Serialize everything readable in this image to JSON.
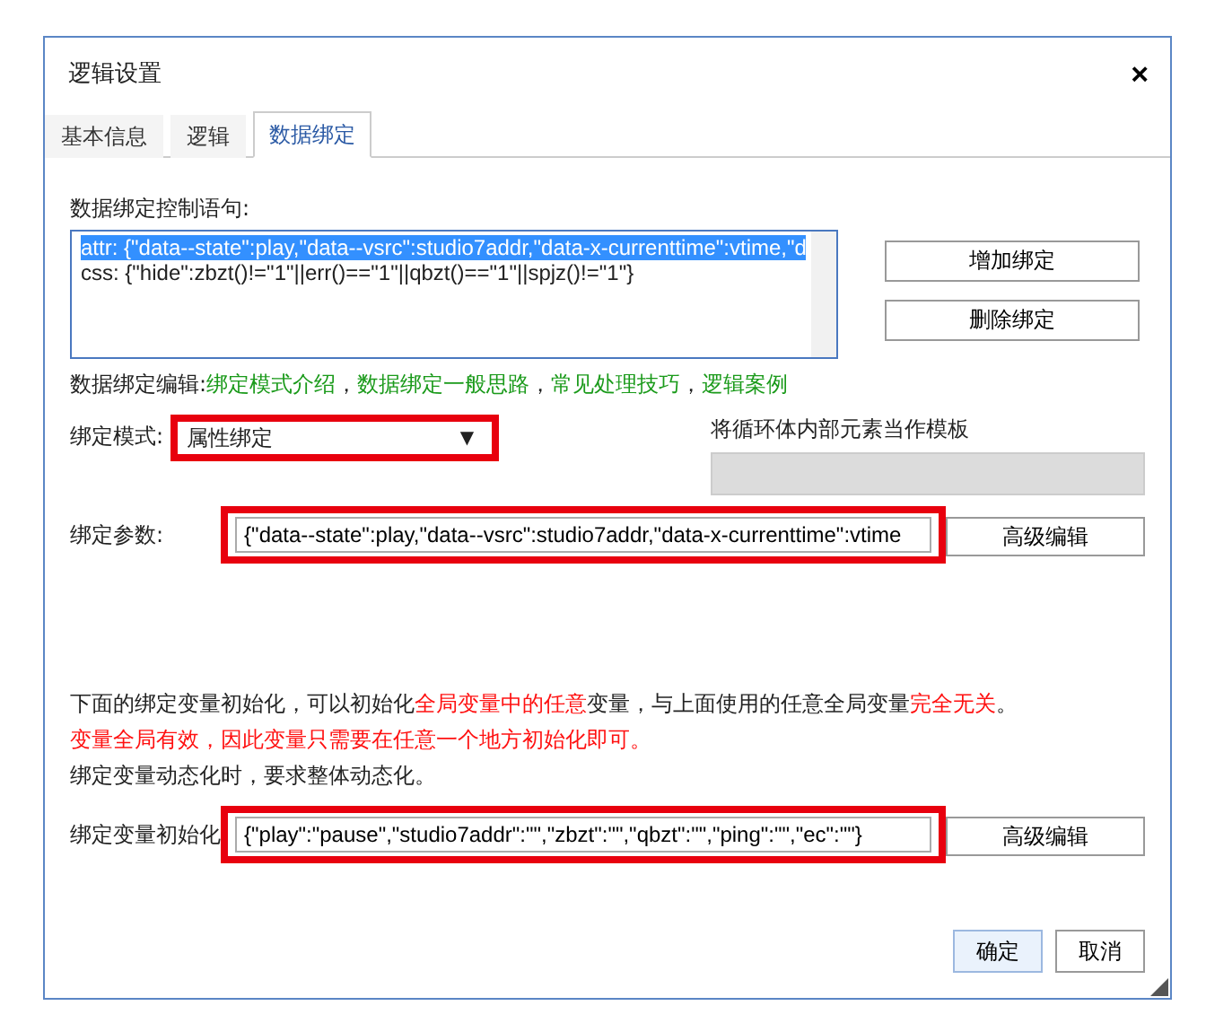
{
  "window": {
    "title": "逻辑设置",
    "close": "×"
  },
  "tabs": [
    {
      "label": "基本信息",
      "selected": false
    },
    {
      "label": "逻辑",
      "selected": false
    },
    {
      "label": "数据绑定",
      "selected": true
    }
  ],
  "statement": {
    "label": "数据绑定控制语句:",
    "lines": [
      {
        "text": "attr: {\"data--state\":play,\"data--vsrc\":studio7addr,\"data-x-currenttime\":vtime,\"d",
        "selected": true
      },
      {
        "text": "css: {\"hide\":zbzt()!=\"1\"||err()==\"1\"||qbzt()==\"1\"||spjz()!=\"1\"}",
        "selected": false
      }
    ]
  },
  "side_buttons": [
    "增加绑定",
    "删除绑定"
  ],
  "edit_links": {
    "label": "数据绑定编辑:",
    "links": [
      "绑定模式介绍",
      "数据绑定一般思路",
      "常见处理技巧",
      "逻辑案例"
    ],
    "separator": "，"
  },
  "mode": {
    "label": "绑定模式:",
    "value": "属性绑定",
    "caret": "▼",
    "highlighted": true
  },
  "template": {
    "label": "将循环体内部元素当作模板",
    "disabled": true
  },
  "params": {
    "label": "绑定参数:",
    "value": "{\"data--state\":play,\"data--vsrc\":studio7addr,\"data-x-currenttime\":vtime",
    "highlighted": true,
    "button": "高级编辑"
  },
  "notes": [
    [
      {
        "text": "下面的绑定变量初始化，可以初始化",
        "emphasis": false
      },
      {
        "text": "全局变量中的任意",
        "emphasis": true
      },
      {
        "text": "变量，与上面使用的任意全局变量",
        "emphasis": false
      },
      {
        "text": "完全无关",
        "emphasis": true
      },
      {
        "text": "。",
        "emphasis": false
      }
    ],
    [
      {
        "text": "变量全局有效，因此变量只需要在任意一个地方初始化即可。",
        "emphasis": true
      }
    ],
    [
      {
        "text": "绑定变量动态化时，要求整体动态化。",
        "emphasis": false
      }
    ]
  ],
  "init": {
    "label": "绑定变量初始化",
    "value": "{\"play\":\"pause\",\"studio7addr\":\"\",\"zbzt\":\"\",\"qbzt\":\"\",\"ping\":\"\",\"ec\":\"\"}",
    "highlighted": true,
    "button": "高级编辑"
  },
  "footer_buttons": [
    {
      "label": "确定",
      "primary": true
    },
    {
      "label": "取消",
      "primary": false
    }
  ]
}
